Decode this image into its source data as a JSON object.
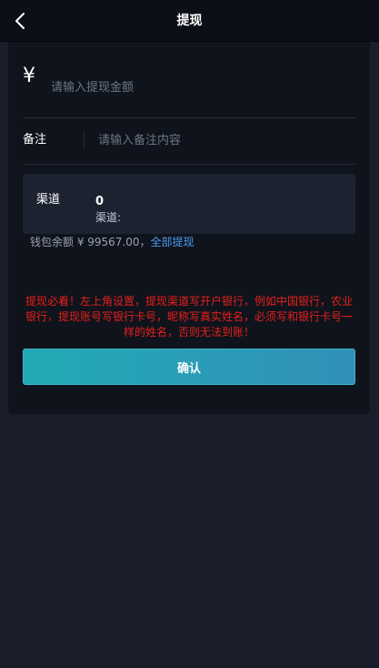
{
  "header": {
    "title": "提现",
    "back_icon": "chevron-left-icon"
  },
  "amount": {
    "currency_symbol": "¥",
    "placeholder": "请输入提现金额",
    "value": ""
  },
  "note": {
    "label": "备注",
    "placeholder": "请输入备注内容",
    "value": ""
  },
  "channel": {
    "label": "渠道",
    "value": "0",
    "sub_label": "渠道:"
  },
  "balance": {
    "text": "钱包余额 ¥ 99567.00，",
    "withdraw_all_label": "全部提现"
  },
  "warning": {
    "text": "提现必看！左上角设置，提现渠道写开户银行，例如中国银行，农业银行，提现账号写银行卡号，昵称写真实姓名，必须写和银行卡号一样的姓名，否则无法到账！"
  },
  "confirm": {
    "label": "确认"
  },
  "colors": {
    "background": "#1a1e2a",
    "card": "#0f131c",
    "accent_link": "#4a9cf0",
    "warning": "#e5201a",
    "button_gradient_start": "#22aab4",
    "button_gradient_end": "#3190b9"
  }
}
